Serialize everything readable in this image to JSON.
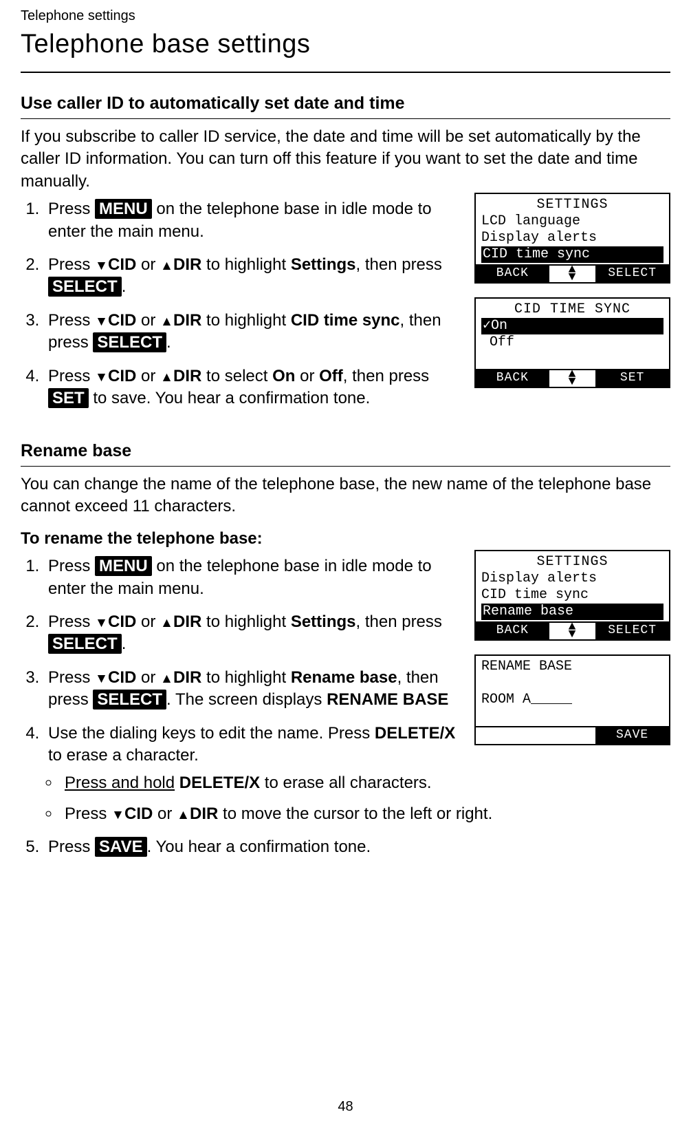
{
  "breadcrumb": "Telephone settings",
  "page_title": "Telephone base settings",
  "section1": {
    "heading": "Use caller ID to automatically set date and time",
    "intro": "If you subscribe to caller ID service, the date and time will be set automatically by the caller ID information. You can turn off this feature if you want to set the date and time manually.",
    "s1_pre": "Press ",
    "s1_menu": "MENU",
    "s1_post": " on the telephone base in idle mode to enter the main menu.",
    "s2_pre": "Press ",
    "s2_cid": "CID",
    "s2_or": " or ",
    "s2_dir": "DIR",
    "s2_mid": " to highlight ",
    "s2_target": "Settings",
    "s2_then": ", then press ",
    "s2_select": "SELECT",
    "s2_end": ".",
    "s3_pre": "Press ",
    "s3_cid": "CID",
    "s3_or": " or ",
    "s3_dir": "DIR",
    "s3_mid": " to highlight ",
    "s3_target": "CID time sync",
    "s3_then": ", then press ",
    "s3_select": "SELECT",
    "s3_end": ".",
    "s4_pre": "Press ",
    "s4_cid": "CID",
    "s4_or": " or ",
    "s4_dir": "DIR",
    "s4_mid": " to select ",
    "s4_on": "On",
    "s4_or2": " or ",
    "s4_off": "Off",
    "s4_then": ", then press ",
    "s4_set": "SET",
    "s4_end": " to save. You hear a confirmation tone."
  },
  "lcd1": {
    "title": "SETTINGS",
    "row1": "LCD language",
    "row2": "Display alerts",
    "row3_hl": "CID time sync",
    "sk_left": "BACK",
    "sk_right": "SELECT"
  },
  "lcd2": {
    "title": "CID TIME SYNC",
    "row1": "✓On",
    "row2": " Off",
    "sk_left": "BACK",
    "sk_right": "SET"
  },
  "section2": {
    "heading": "Rename base",
    "intro": "You can change the name of the telephone base, the new name of the telephone base cannot exceed 11 characters.",
    "subheading": "To rename the telephone base:",
    "s1_pre": "Press ",
    "s1_menu": "MENU",
    "s1_post": " on the telephone base in idle mode to enter the main menu.",
    "s2_pre": "Press ",
    "s2_cid": "CID",
    "s2_or": " or ",
    "s2_dir": "DIR",
    "s2_mid": " to highlight ",
    "s2_target": "Settings",
    "s2_then": ", then press ",
    "s2_select": "SELECT",
    "s2_end": ".",
    "s3_pre": "Press ",
    "s3_cid": "CID",
    "s3_or": " or ",
    "s3_dir": "DIR",
    "s3_mid": " to highlight ",
    "s3_target": "Rename base",
    "s3_then": ", then press ",
    "s3_select": "SELECT",
    "s3_post": ". The screen displays ",
    "s3_screen": "RENAME BASE",
    "s4_pre": "Use the dialing keys to edit the name. Press ",
    "s4_key": "DELETE/X",
    "s4_post": " to erase a character.",
    "b1_pre_u": "Press and hold",
    "b1_sp": " ",
    "b1_key": "DELETE/X",
    "b1_post": " to erase all characters.",
    "b2_pre": "Press ",
    "b2_cid": "CID",
    "b2_or": " or ",
    "b2_dir": "DIR",
    "b2_post": " to move the cursor to the left or right.",
    "s5_pre": "Press ",
    "s5_save": "SAVE",
    "s5_post": ". You hear a confirmation tone."
  },
  "lcd3": {
    "title": "SETTINGS",
    "row1": "Display alerts",
    "row2": "CID time sync",
    "row3_hl": "Rename base",
    "sk_left": "BACK",
    "sk_right": "SELECT"
  },
  "lcd4": {
    "title": "RENAME BASE",
    "row1": "ROOM A_____",
    "sk_right": "SAVE"
  },
  "page_number": "48"
}
